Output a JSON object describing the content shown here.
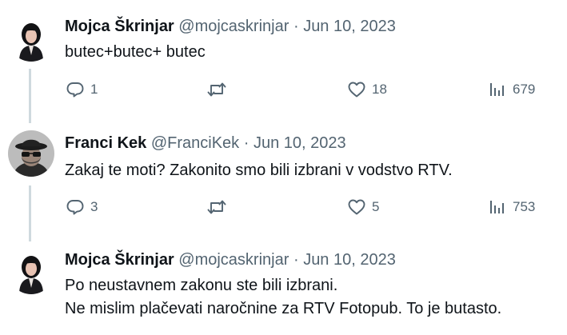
{
  "tweets": [
    {
      "name": "Mojca Škrinjar",
      "handle": "@mojcaskrinjar",
      "separator": "·",
      "date": "Jun 10, 2023",
      "lines": [
        "butec+butec+ butec"
      ],
      "replies": "1",
      "retweets": "",
      "likes": "18",
      "views": "679",
      "avatar": "woman-dark-hair-portrait"
    },
    {
      "name": "Franci Kek",
      "handle": "@FranciKek",
      "separator": "·",
      "date": "Jun 10, 2023",
      "lines": [
        "Zakaj te moti? Zakonito smo bili izbrani v vodstvo RTV."
      ],
      "replies": "3",
      "retweets": "",
      "likes": "5",
      "views": "753",
      "avatar": "man-hat-sunglasses-portrait"
    },
    {
      "name": "Mojca Škrinjar",
      "handle": "@mojcaskrinjar",
      "separator": "·",
      "date": "Jun 10, 2023",
      "lines": [
        "Po neustavnem zakonu ste bili izbrani.",
        "Ne mislim plačevati naročnine za RTV Fotopub. To je butasto."
      ],
      "avatar": "woman-dark-hair-portrait"
    }
  ],
  "icons": {
    "reply": "reply-bubble-icon",
    "retweet": "retweet-arrows-icon",
    "like": "heart-icon",
    "views": "analytics-bars-icon"
  },
  "colors": {
    "text": "#0f1419",
    "secondary": "#536471",
    "thread_line": "#cfd9de",
    "background": "#ffffff"
  }
}
